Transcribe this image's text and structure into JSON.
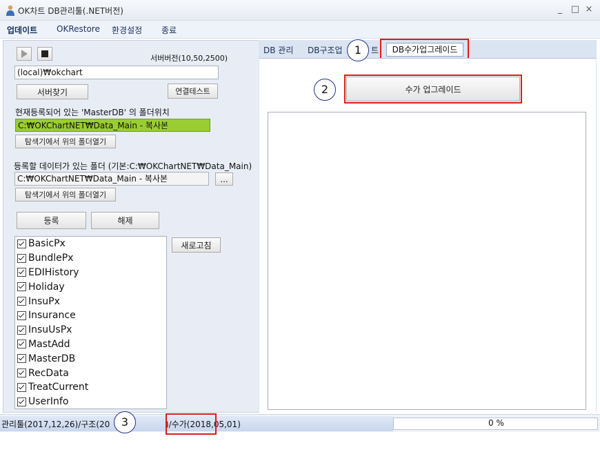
{
  "window": {
    "title": "OK차트 DB관리툴(.NET버전)",
    "controls": [
      "_",
      "□",
      "×"
    ]
  },
  "menu": {
    "items": [
      "업데이트",
      "OKRestore",
      "환경설정",
      "종료"
    ]
  },
  "server": {
    "version_label": "서버버전(10,50,2500)",
    "server_name": "(local)₩okchart",
    "find_button": "서버찾기",
    "test_button": "연결테스트"
  },
  "master_db": {
    "label": "현재등록되어 있는 'MasterDB' 의 폴더위치",
    "path": "C:₩OKChartNET₩Data_Main - 복사본",
    "open_button": "탐색기에서 위의 폴더열기"
  },
  "register_folder": {
    "label": "등록할 데이터가 있는 폴더 (기본:C:₩OKChartNET₩Data_Main)",
    "path": "C:₩OKChartNET₩Data_Main - 복사본",
    "browse_button": "...",
    "open_button": "탐색기에서 위의 폴더열기"
  },
  "actions": {
    "register_button": "등록",
    "release_button": "해제",
    "refresh_button": "새로고침"
  },
  "db_list": {
    "items": [
      "BasicPx",
      "BundlePx",
      "EDIHistory",
      "Holiday",
      "InsuPx",
      "Insurance",
      "InsuUsPx",
      "MastAdd",
      "MasterDB",
      "RecData",
      "TreatCurrent",
      "UserInfo"
    ]
  },
  "tabs": {
    "items": [
      "DB 관리",
      "DB구조업",
      "트"
    ],
    "active": "DB수가업그레이드"
  },
  "upgrade": {
    "button": "수가 업그레이드"
  },
  "callouts": [
    "1",
    "2",
    "3"
  ],
  "status": {
    "left_text": "관리툴(2017,12,26)/구조(20",
    "highlight_text": ")/수가(2018,05,01)",
    "progress": "0 %",
    "progress_value": 0
  },
  "colors": {
    "highlight_red": "#e21818",
    "path_green": "#9acd32"
  }
}
